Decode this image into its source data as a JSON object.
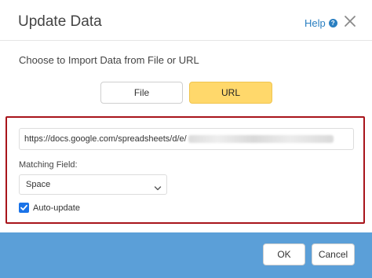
{
  "dialog": {
    "title": "Update Data",
    "help_label": "Help",
    "help_icon": "?",
    "close_icon": "close-icon"
  },
  "source": {
    "prompt": "Choose to Import Data from File or URL",
    "options": [
      "File",
      "URL"
    ],
    "selected": "URL"
  },
  "form": {
    "url_visible": "https://docs.google.com/spreadsheets/d/e/",
    "matching_field_label": "Matching Field:",
    "matching_field_value": "Space",
    "auto_update_label": "Auto-update",
    "auto_update_checked": true
  },
  "footer": {
    "ok_label": "OK",
    "cancel_label": "Cancel"
  },
  "colors": {
    "accent_yellow": "#ffd86b",
    "footer_blue": "#5b9fd8",
    "highlight_red": "#a8141b",
    "link_blue": "#2a7fc1",
    "checkbox_blue": "#1a73e8"
  }
}
